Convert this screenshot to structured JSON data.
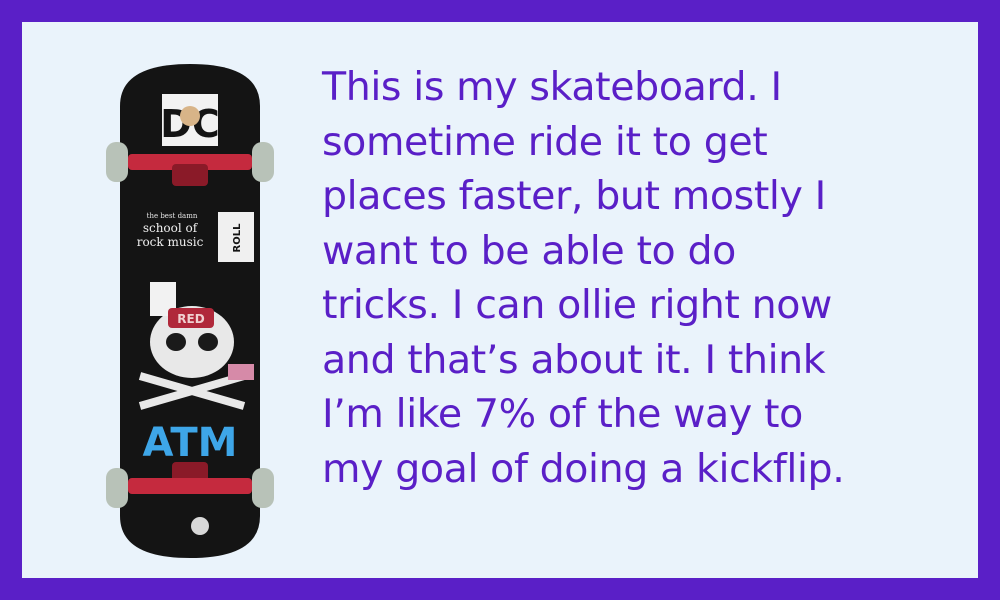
{
  "caption_lines": [
    "This is my skateboard. I",
    "sometime ride it to get",
    "places faster, but mostly I",
    "want to be able to do",
    "tricks. I can ollie right now",
    "and that’s about it. I think",
    "I’m like 7% of the way to",
    "my goal of doing a kickflip."
  ],
  "stickers": {
    "top_brand": "DC",
    "school_small": "the best damn",
    "school_line1": "school of",
    "school_line2": "rock music",
    "roll_box": "ROLL",
    "red_sticker": "RED",
    "bottom_logo": "ATM"
  },
  "colors": {
    "border": "#5a1fc7",
    "background": "#eaf3fb",
    "text": "#5a1fc7"
  }
}
